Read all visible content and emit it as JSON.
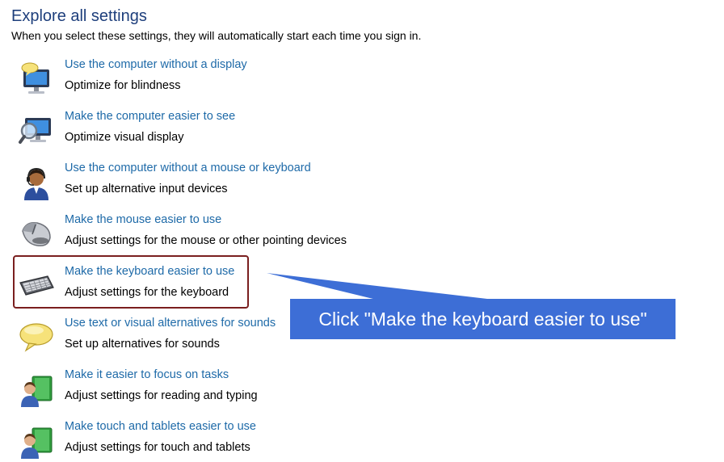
{
  "header": {
    "title": "Explore all settings",
    "subtitle": "When you select these settings, they will automatically start each time you sign in."
  },
  "items": [
    {
      "link": "Use the computer without a display",
      "desc": "Optimize for blindness",
      "icon": "monitor-speech-icon"
    },
    {
      "link": "Make the computer easier to see",
      "desc": "Optimize visual display",
      "icon": "magnifier-monitor-icon"
    },
    {
      "link": "Use the computer without a mouse or keyboard",
      "desc": "Set up alternative input devices",
      "icon": "headset-person-icon"
    },
    {
      "link": "Make the mouse easier to use",
      "desc": "Adjust settings for the mouse or other pointing devices",
      "icon": "mouse-icon"
    },
    {
      "link": "Make the keyboard easier to use",
      "desc": "Adjust settings for the keyboard",
      "icon": "keyboard-icon"
    },
    {
      "link": "Use text or visual alternatives for sounds",
      "desc": "Set up alternatives for sounds",
      "icon": "speech-bubble-icon"
    },
    {
      "link": "Make it easier to focus on tasks",
      "desc": "Adjust settings for reading and typing",
      "icon": "person-book-icon"
    },
    {
      "link": "Make touch and tablets easier to use",
      "desc": "Adjust settings for touch and tablets",
      "icon": "person-tablet-icon"
    }
  ],
  "callout": {
    "text": "Click \"Make the keyboard easier to use\""
  },
  "colors": {
    "link": "#1e6aa8",
    "title": "#1e3f7c",
    "callout_bg": "#3d6ed6",
    "highlight_border": "#7a1f1f"
  }
}
